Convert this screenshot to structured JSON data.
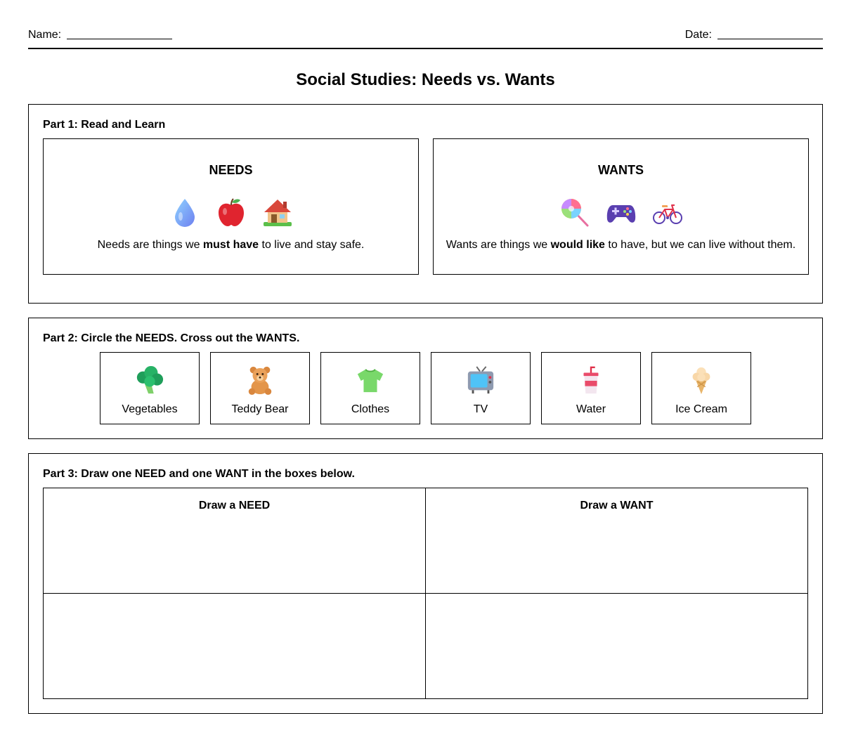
{
  "header": {
    "name_label": "Name:",
    "date_label": "Date:"
  },
  "title": "Social Studies: Needs vs. Wants",
  "part1": {
    "title": "Part 1: Read and Learn",
    "needs": {
      "heading": "NEEDS",
      "icons": [
        "water-drop-icon",
        "apple-icon",
        "house-icon"
      ],
      "desc_before": "Needs are things we ",
      "desc_bold": "must have",
      "desc_after": " to live and stay safe."
    },
    "wants": {
      "heading": "WANTS",
      "icons": [
        "lollipop-icon",
        "game-controller-icon",
        "bicycle-icon"
      ],
      "desc_before": "Wants are things we ",
      "desc_bold": "would like",
      "desc_after": " to have, but we can live without them."
    }
  },
  "part2": {
    "title": "Part 2: Circle the NEEDS. Cross out the WANTS.",
    "items": [
      {
        "label": "Vegetables",
        "icon": "broccoli-icon"
      },
      {
        "label": "Teddy Bear",
        "icon": "teddy-bear-icon"
      },
      {
        "label": "Clothes",
        "icon": "t-shirt-icon"
      },
      {
        "label": "TV",
        "icon": "television-icon"
      },
      {
        "label": "Water",
        "icon": "cup-with-straw-icon"
      },
      {
        "label": "Ice Cream",
        "icon": "ice-cream-icon"
      }
    ]
  },
  "part3": {
    "title": "Part 3: Draw one NEED and one WANT in the boxes below.",
    "need_label": "Draw a NEED",
    "want_label": "Draw a WANT"
  }
}
